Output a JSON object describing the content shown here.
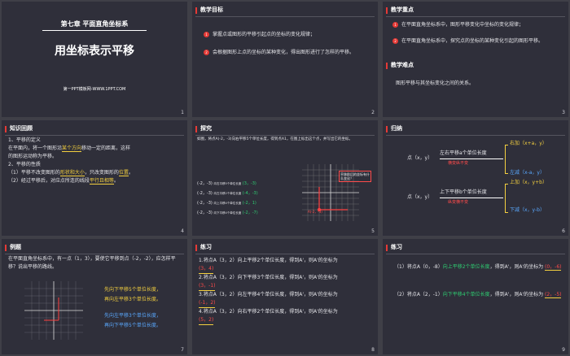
{
  "slides": [
    {
      "chapter": "第七章 平面直角坐标系",
      "title": "用坐标表示平移",
      "site": "第一PPT模板网-WWW.1PPT.COM",
      "num": "1"
    },
    {
      "heading": "教学目标",
      "items": [
        "掌握点或图形的平移引起点的坐标的变化规律；",
        "会根据图形上点的坐标的某种变化，得出图形进行了怎样的平移。"
      ],
      "num": "2"
    },
    {
      "heading": "教学重点",
      "items": [
        "在平面直角坐标系中，图形平移变化中坐标的变化规律；",
        "在平面直角坐标系中，探究点的坐标的某种变化引起的图形平移。"
      ],
      "heading2": "教学难点",
      "body2": "图形平移与其坐标变化之间的关系。",
      "num": "3"
    },
    {
      "heading": "知识回顾",
      "l1": "1、平移的定义",
      "l2a": "在平面内，将一个图形沿",
      "l2b": "某个方向",
      "l2c": "移动一定的距离，这样",
      "l3": "的图形运动称为平移。",
      "l4": "2、平移的性质",
      "l5a": "（1）平移不改变图形的",
      "l5b": "形状和大小",
      "l5c": "，只改变图形的",
      "l5d": "位置",
      "l5e": "。",
      "l6a": "（2）经过平移后，对应点所连的线段",
      "l6b": "平行且相等",
      "l6c": "。",
      "num": "4"
    },
    {
      "heading": "探究",
      "intro": "如图，将点A(-2，-3)向右平移5个单位长度，得到点A1，在图上标出这个点，并写出它的坐标。",
      "rows": [
        {
          "from": "(-2，-3)",
          "op": "向右平移5个单位长度",
          "to": "(3，-3)"
        },
        {
          "from": "(-2，-3)",
          "op": "向左平移2个单位长度",
          "to": "(-4，-3)"
        },
        {
          "from": "(-2，-3)",
          "op": "向上平移4个单位长度",
          "to": "(-2，1)"
        },
        {
          "from": "(-2，-3)",
          "op": "向下平移4个单位长度",
          "to": "(-2，-7)"
        }
      ],
      "box": "平移前后的坐标有什么变化？",
      "label_a": "A(-2，-3)",
      "num": "5"
    },
    {
      "heading": "归纳",
      "point": "点（x，y）",
      "lr": "左右平移a个单位长度",
      "lr_sub": "横变纵不变",
      "ud": "上下平移b个单位长度",
      "ud_sub": "纵变横不变",
      "right_add": "右加（x+a，y）",
      "left_sub": "左减（x-a，y）",
      "up_add": "上加（x，y+b）",
      "down_sub": "下减（x，y-b）",
      "num": "6"
    },
    {
      "heading": "例题",
      "q": "在平面直角坐标系中，有一点（1，3），要使它平移到点（-2，-2），应怎样平移？说出平移的路线。",
      "a1": "先向下平移5个单位长度，",
      "a2": "再向左平移3个单位长度。",
      "a3": "先向左平移3个单位长度，",
      "a4": "再向下平移5个单位长度。",
      "num": "7"
    },
    {
      "heading": "练习",
      "q1": "1.将点A（3，2）向上平移2个单位长度，得到A'，则A'的坐标为",
      "a1": "(3，4)",
      "q2": "2.将点A（3，2）向下平移3个单位长度，得到A'，则A'的坐标为",
      "a2": "(3，-1)",
      "q3": "3.将点A（3，2）向左平移4个单位长度，得到A'，则A'的坐标为",
      "a3": "(-1，2)",
      "q4": "4.将点A（3，2）向右平移2个单位长度，得到A'，则A'的坐标为",
      "a4": "(5，2)",
      "num": "8"
    },
    {
      "heading": "练习",
      "q1a": "（1）将点A（0，-8）",
      "q1b": "向上平移2个单位长度",
      "q1c": "，得到A'，则A'的坐标为",
      "a1": "(0，-6)",
      "q2a": "（2）将点A（2，-1）",
      "q2b": "向下平移4个单位长度",
      "q2c": "，得到A'，则A'的坐标为",
      "a2": "(2，-5)",
      "num": "9"
    }
  ]
}
